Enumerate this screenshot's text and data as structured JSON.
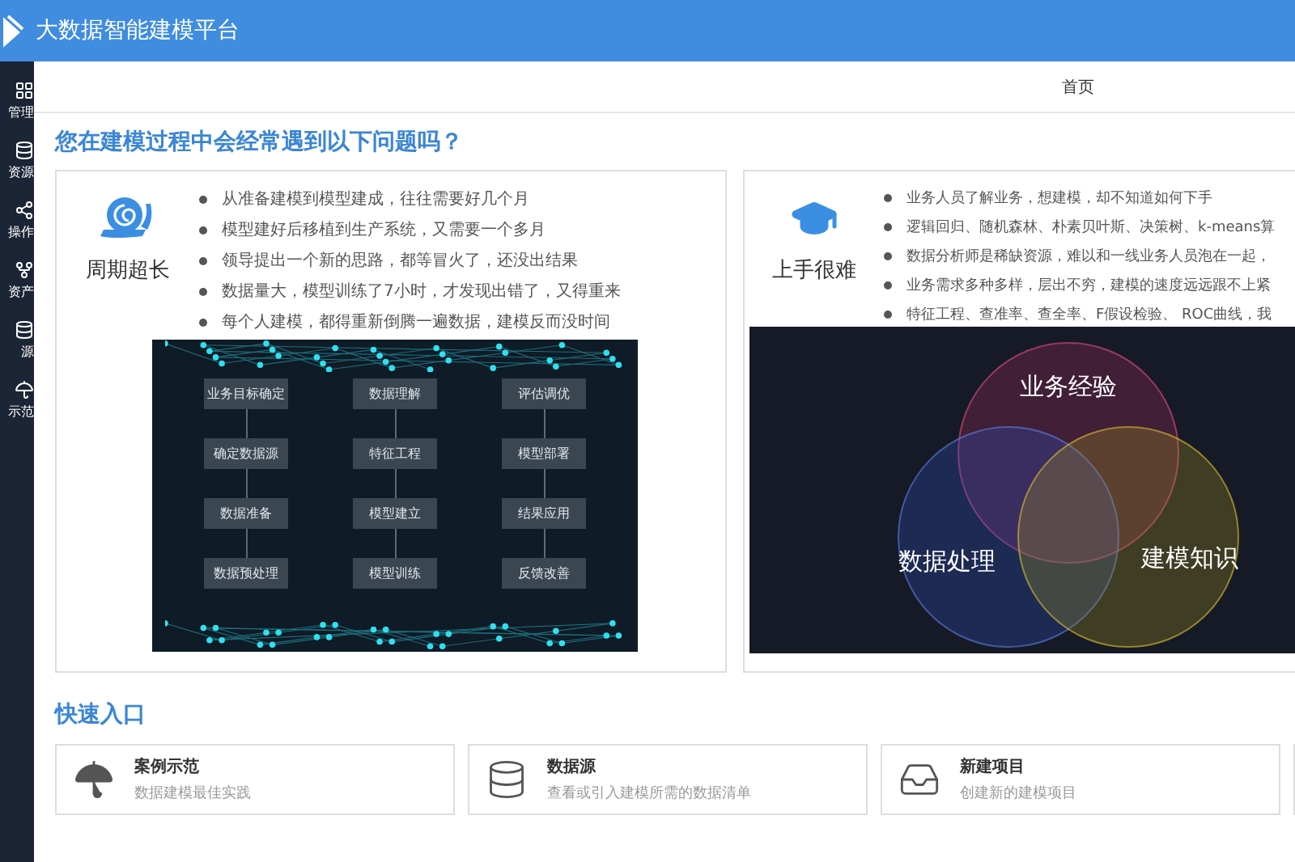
{
  "header": {
    "title": "大数据智能建模平台"
  },
  "sidebar": {
    "items": [
      {
        "label": "管理"
      },
      {
        "label": "资源"
      },
      {
        "label": "操作"
      },
      {
        "label": "资产"
      },
      {
        "label": "源"
      },
      {
        "label": "示范"
      }
    ]
  },
  "breadcrumb": "首页",
  "problems": {
    "title": "您在建模过程中会经常遇到以下问题吗？",
    "cards": [
      {
        "title": "周期超长",
        "bullets": [
          "从准备建模到模型建成，往往需要好几个月",
          "模型建好后移植到生产系统，又需要一个多月",
          "领导提出一个新的思路，都等冒火了，还没出结果",
          "数据量大，模型训练了7小时，才发现出错了，又得重来",
          "每个人建模，都得重新倒腾一遍数据，建模反而没时间"
        ],
        "figure": {
          "kind": "flowchart",
          "columns": [
            [
              "业务目标确定",
              "确定数据源",
              "数据准备",
              "数据预处理"
            ],
            [
              "数据理解",
              "特征工程",
              "模型建立",
              "模型训练"
            ],
            [
              "评估调优",
              "模型部署",
              "结果应用",
              "反馈改善"
            ]
          ]
        }
      },
      {
        "title": "上手很难",
        "bullets": [
          "业务人员了解业务，想建模，却不知道如何下手",
          "逻辑回归、随机森林、朴素贝叶斯、决策树、k-means算",
          "数据分析师是稀缺资源，难以和一线业务人员泡在一起，",
          "业务需求多种多样，层出不穷，建模的速度远远跟不上紧",
          "特征工程、查准率、查全率、F假设检验、 ROC曲线，我"
        ],
        "figure": {
          "kind": "venn",
          "labels": [
            "业务经验",
            "数据处理",
            "建模知识"
          ]
        }
      }
    ]
  },
  "quick_entry": {
    "title": "快速入口",
    "items": [
      {
        "title": "案例示范",
        "subtitle": "数据建模最佳实践"
      },
      {
        "title": "数据源",
        "subtitle": "查看或引入建模所需的数据清单"
      },
      {
        "title": "新建项目",
        "subtitle": "创建新的建模项目"
      }
    ]
  }
}
